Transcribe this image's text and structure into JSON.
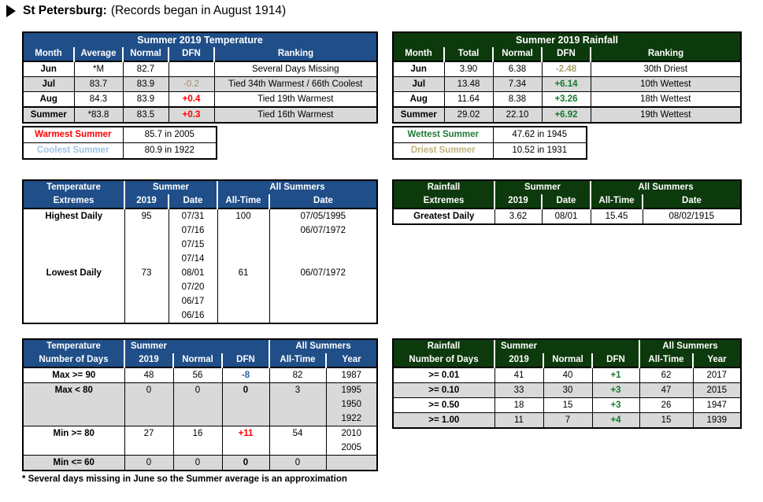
{
  "header": {
    "bullet_icon": "triangle-right-icon",
    "city": "St Petersburg:",
    "note": "(Records began in August 1914)"
  },
  "colors": {
    "temperature_header": "#1F4E88",
    "rainfall_header": "#0C3A0C",
    "positive_temp": "#FF0000",
    "positive_rain": "#137A2E",
    "shade_row": "#D9D9D9"
  },
  "temp_summary": {
    "title": "Summer 2019 Temperature",
    "columns": [
      "Month",
      "Average",
      "Normal",
      "DFN",
      "Ranking"
    ],
    "rows": [
      {
        "month": "Jun",
        "average": "*M",
        "normal": "82.7",
        "dfn": "",
        "ranking": "Several Days Missing"
      },
      {
        "month": "Jul",
        "average": "83.7",
        "normal": "83.9",
        "dfn": "-0.2",
        "ranking": "Tied 34th Warmest / 66th Coolest"
      },
      {
        "month": "Aug",
        "average": "84.3",
        "normal": "83.9",
        "dfn": "+0.4",
        "ranking": "Tied 19th Warmest"
      },
      {
        "month": "Summer",
        "average": "*83.8",
        "normal": "83.5",
        "dfn": "+0.3",
        "ranking": "Tied 16th Warmest"
      }
    ]
  },
  "rain_summary": {
    "title": "Summer 2019 Rainfall",
    "columns": [
      "Month",
      "Total",
      "Normal",
      "DFN",
      "Ranking"
    ],
    "rows": [
      {
        "month": "Jun",
        "total": "3.90",
        "normal": "6.38",
        "dfn": "-2.48",
        "ranking": "30th Driest"
      },
      {
        "month": "Jul",
        "total": "13.48",
        "normal": "7.34",
        "dfn": "+6.14",
        "ranking": "10th Wettest"
      },
      {
        "month": "Aug",
        "total": "11.64",
        "normal": "8.38",
        "dfn": "+3.26",
        "ranking": "18th Wettest"
      },
      {
        "month": "Summer",
        "total": "29.02",
        "normal": "22.10",
        "dfn": "+6.92",
        "ranking": "19th Wettest"
      }
    ]
  },
  "temp_records": {
    "rows": [
      {
        "label": "Warmest Summer",
        "value": "85.7 in 2005"
      },
      {
        "label": "Coolest Summer",
        "value": "80.9 in 1922"
      }
    ]
  },
  "rain_records": {
    "rows": [
      {
        "label": "Wettest Summer",
        "value": "47.62 in 1945"
      },
      {
        "label": "Driest Summer",
        "value": "10.52 in 1931"
      }
    ]
  },
  "temp_extremes": {
    "header": {
      "corner_line1": "Temperature",
      "corner_line2": "Extremes",
      "group_summer": "Summer",
      "summer_year": "2019",
      "summer_date": "Date",
      "group_all": "All Summers",
      "all_time": "All-Time",
      "all_date": "Date"
    },
    "rows": [
      {
        "label": "Highest Daily",
        "value": "95",
        "dates": [
          "07/31",
          "07/16",
          "07/15",
          "07/14"
        ],
        "all_time": "100",
        "all_dates": [
          "07/05/1995",
          "06/07/1972"
        ]
      },
      {
        "label": "Lowest Daily",
        "value": "73",
        "dates": [
          "08/01",
          "07/20",
          "06/17",
          "06/16"
        ],
        "all_time": "61",
        "all_dates": [
          "06/07/1972"
        ]
      }
    ]
  },
  "rain_extremes": {
    "header": {
      "corner_line1": "Rainfall",
      "corner_line2": "Extremes",
      "group_summer": "Summer",
      "summer_year": "2019",
      "summer_date": "Date",
      "group_all": "All Summers",
      "all_time": "All-Time",
      "all_date": "Date"
    },
    "rows": [
      {
        "label": "Greatest Daily",
        "value": "3.62",
        "date": "08/01",
        "all_time": "15.45",
        "all_date": "08/02/1915"
      }
    ]
  },
  "temp_days": {
    "header": {
      "corner_line1": "Temperature",
      "corner_line2": "Number of Days",
      "summer_line1": "Summer",
      "summer_line2": "2019",
      "normal": "Normal",
      "dfn": "DFN",
      "group_all": "All Summers",
      "all_time": "All-Time",
      "year": "Year"
    },
    "rows": [
      {
        "label": "Max >= 90",
        "summer": "48",
        "normal": "56",
        "dfn": "-8",
        "dfn_style": "neg-blue",
        "all_time": "82",
        "years": [
          "1987"
        ],
        "shaded": false
      },
      {
        "label": "Max < 80",
        "summer": "0",
        "normal": "0",
        "dfn": "0",
        "dfn_style": "zero-blk",
        "all_time": "3",
        "years": [
          "1995",
          "1950",
          "1922"
        ],
        "shaded": true
      },
      {
        "label": "Min >= 80",
        "summer": "27",
        "normal": "16",
        "dfn": "+11",
        "dfn_style": "pos-red",
        "all_time": "54",
        "years": [
          "2010",
          "2005"
        ],
        "shaded": false
      },
      {
        "label": "Min <= 60",
        "summer": "0",
        "normal": "0",
        "dfn": "0",
        "dfn_style": "zero-blk",
        "all_time": "0",
        "years": [
          ""
        ],
        "shaded": true
      }
    ]
  },
  "rain_days": {
    "header": {
      "corner_line1": "Rainfall",
      "corner_line2": "Number of Days",
      "summer_line1": "Summer",
      "summer_line2": "2019",
      "normal": "Normal",
      "dfn": "DFN",
      "group_all": "All Summers",
      "all_time": "All-Time",
      "year": "Year"
    },
    "rows": [
      {
        "label": ">= 0.01",
        "summer": "41",
        "normal": "40",
        "dfn": "+1",
        "all_time": "62",
        "year": "2017",
        "shaded": false
      },
      {
        "label": ">= 0.10",
        "summer": "33",
        "normal": "30",
        "dfn": "+3",
        "all_time": "47",
        "year": "2015",
        "shaded": true
      },
      {
        "label": ">= 0.50",
        "summer": "18",
        "normal": "15",
        "dfn": "+3",
        "all_time": "26",
        "year": "1947",
        "shaded": false
      },
      {
        "label": ">= 1.00",
        "summer": "11",
        "normal": "7",
        "dfn": "+4",
        "all_time": "15",
        "year": "1939",
        "shaded": true
      }
    ]
  },
  "footnote": "* Several days missing in June so the Summer average is an approximation"
}
